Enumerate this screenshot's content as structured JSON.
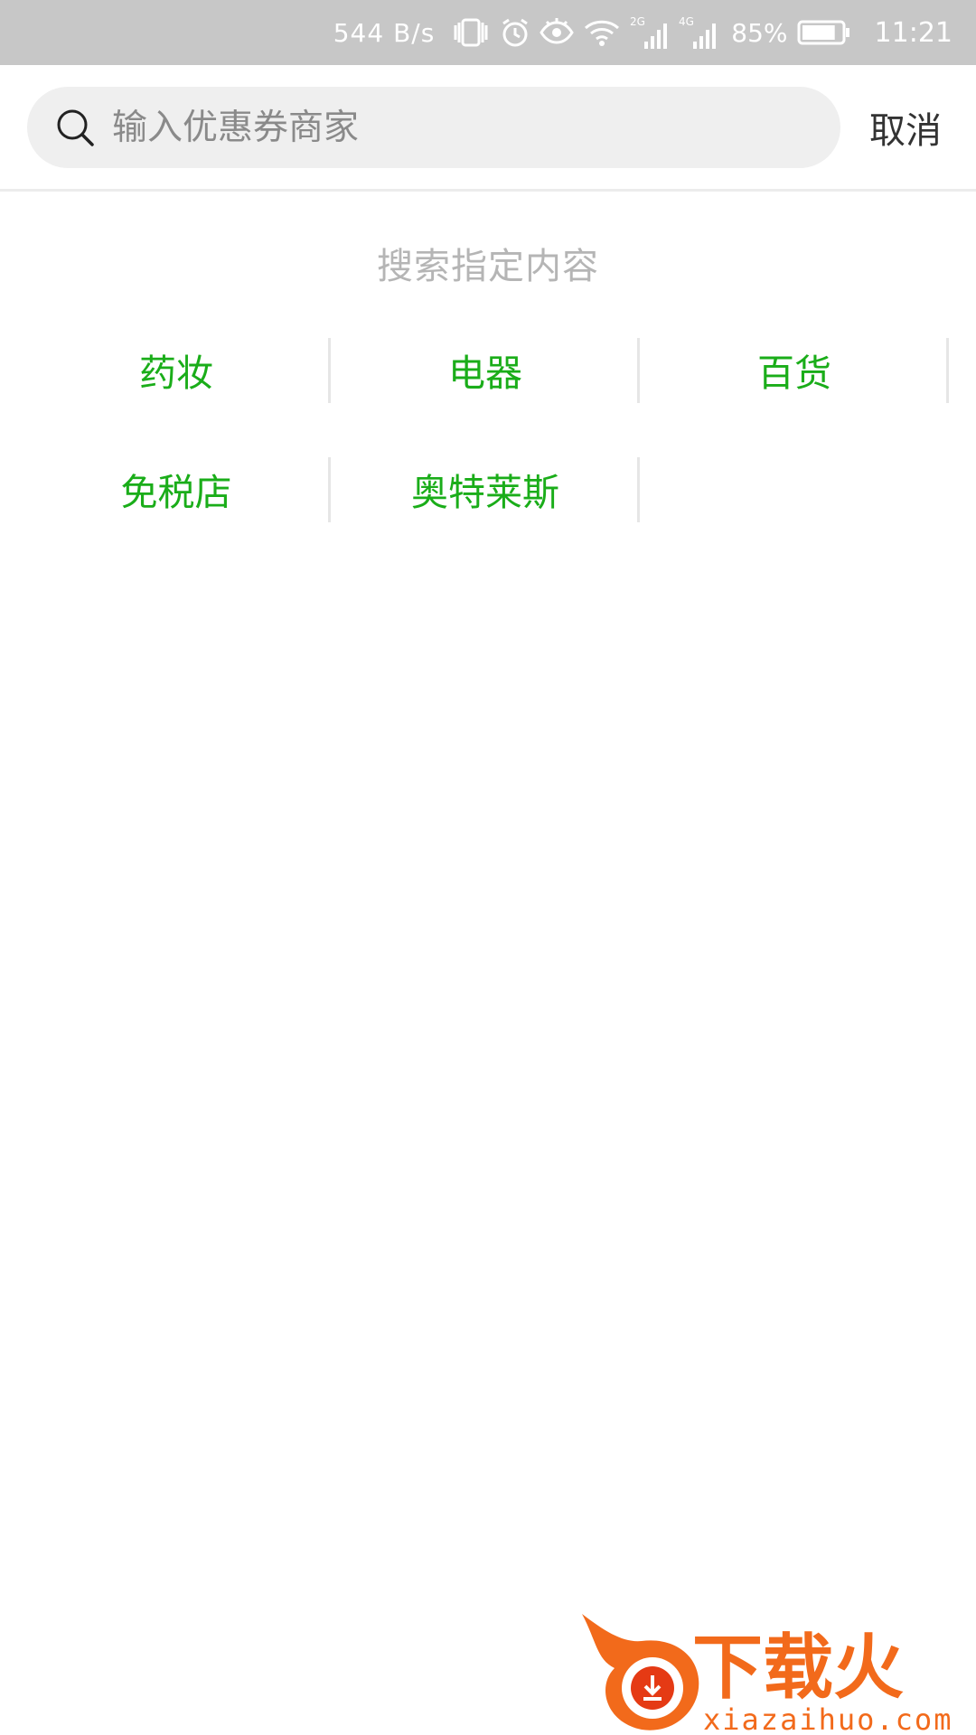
{
  "status_bar": {
    "net_speed": "544 B/s",
    "sim1_label": "2G",
    "sim2_label": "4G",
    "battery_percent": "85%",
    "battery_level": 0.85,
    "time": "11:21",
    "icons": [
      "vibrate-icon",
      "alarm-icon",
      "eye-comfort-icon",
      "wifi-icon",
      "signal-2g-icon",
      "signal-4g-icon",
      "battery-icon"
    ]
  },
  "search": {
    "placeholder": "输入优惠券商家",
    "value": "",
    "cancel_label": "取消"
  },
  "section_title": "搜索指定内容",
  "categories": [
    {
      "label": "药妆"
    },
    {
      "label": "电器"
    },
    {
      "label": "百货"
    },
    {
      "label": "免税店"
    },
    {
      "label": "奥特莱斯"
    }
  ],
  "watermark": {
    "brand": "下载火",
    "url": "xiazaihuo.com"
  },
  "colors": {
    "accent_green": "#1aad19",
    "status_bar_bg": "#c7c7c7",
    "search_bg": "#efefef",
    "watermark_orange": "#f26a1b"
  }
}
